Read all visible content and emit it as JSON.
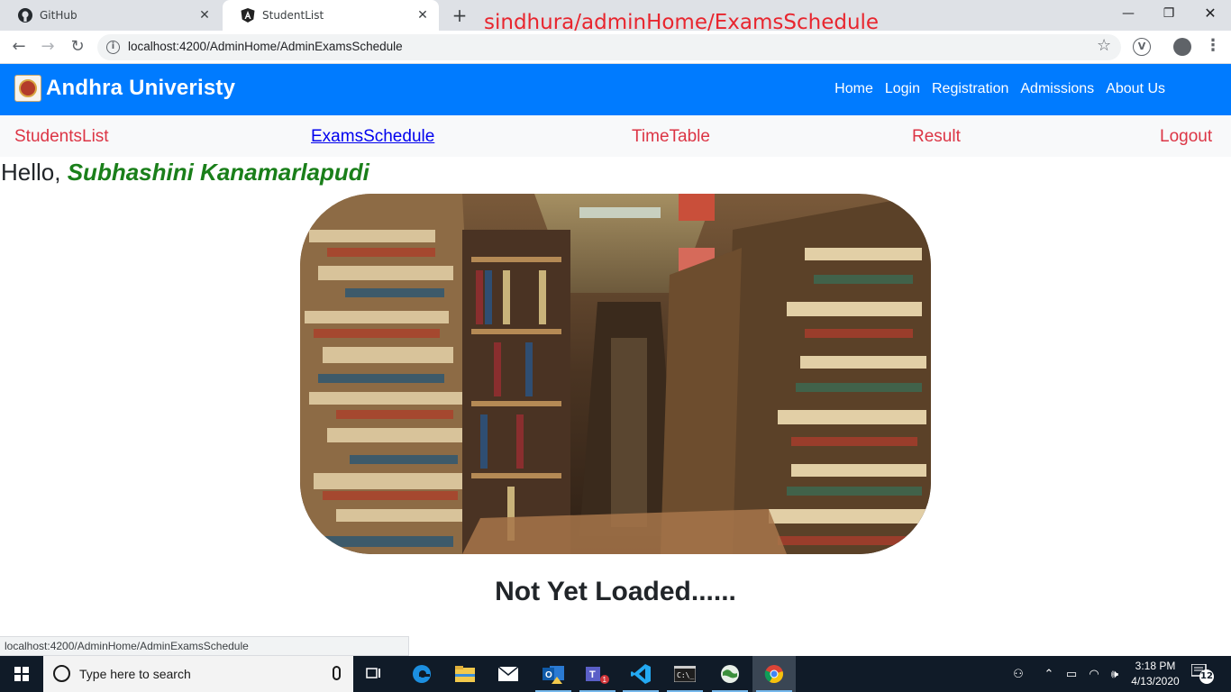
{
  "browser": {
    "tabs": [
      {
        "label": "GitHub",
        "icon": "github-icon"
      },
      {
        "label": "StudentList",
        "icon": "angular-icon"
      }
    ],
    "new_tab_symbol": "+",
    "url": "localhost:4200/AdminHome/AdminExamsSchedule",
    "status_url": "localhost:4200/AdminHome/AdminExamsSchedule",
    "overlay_caption": "sindhura/adminHome/ExamsSchedule"
  },
  "navbar": {
    "brand": "Andhra Univeristy",
    "links": [
      "Home",
      "Login",
      "Registration",
      "Admissions",
      "About Us"
    ],
    "background": "#007bff"
  },
  "subnav": {
    "items": [
      "StudentsList",
      "ExamsSchedule",
      "TimeTable",
      "Result",
      "Logout"
    ],
    "current": "ExamsSchedule",
    "link_color": "#dc3545"
  },
  "greeting": {
    "prefix": "Hello,",
    "user": "Subhashini Kanamarlapudi"
  },
  "main": {
    "status_message": "Not Yet Loaded......"
  },
  "taskbar": {
    "search_placeholder": "Type here to search",
    "time": "3:18 PM",
    "date": "4/13/2020",
    "notification_count": "12",
    "teams_badge": "1"
  }
}
